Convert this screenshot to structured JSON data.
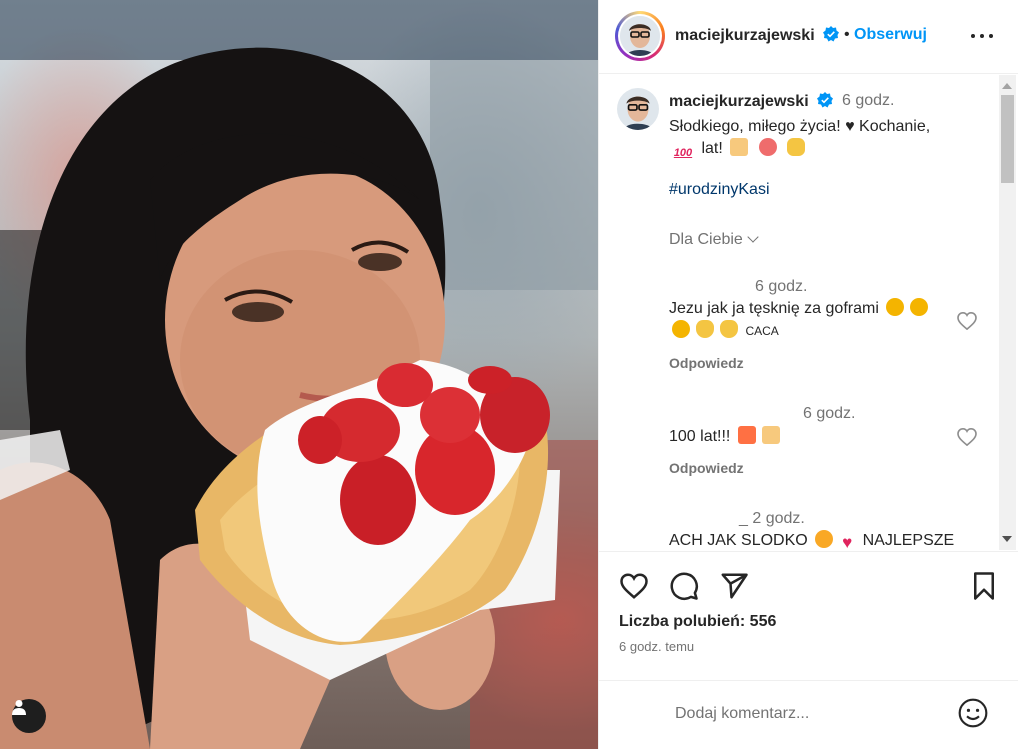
{
  "post": {
    "username": "maciejkurzajewski",
    "verified": true,
    "follow_label": "Obserwuj",
    "separator": "•",
    "more_icon": "more-horizontal-icon"
  },
  "caption": {
    "username": "maciejkurzajewski",
    "time": "6 godz.",
    "text_line1": "Słodkiego, miłego życia! ♥ Kochanie,",
    "text_line2_word": "lat!",
    "hashtag": "#urodzinyKasi",
    "for_you": "Dla Ciebie"
  },
  "comments": [
    {
      "time": "6 godz.",
      "text_line1": "Jezu jak ja tęsknię za goframi",
      "text_line2": "CACA",
      "reply": "Odpowiedz"
    },
    {
      "time": "6 godz.",
      "text": "100 lat!!!",
      "reply": "Odpowiedz"
    },
    {
      "time": "_ 2 godz.",
      "text_start": "ACH JAK SLODKO",
      "text_end": "NAJLEPSZE"
    }
  ],
  "actions": {
    "likes": "Liczba polubień: 556",
    "posted_ago": "6 godz. temu"
  },
  "add_comment": {
    "placeholder": "Dodaj komentarz..."
  },
  "colors": {
    "link_blue": "#0095f6",
    "hashtag_blue": "#00376b",
    "muted_text": "#737373",
    "text": "#262626"
  }
}
